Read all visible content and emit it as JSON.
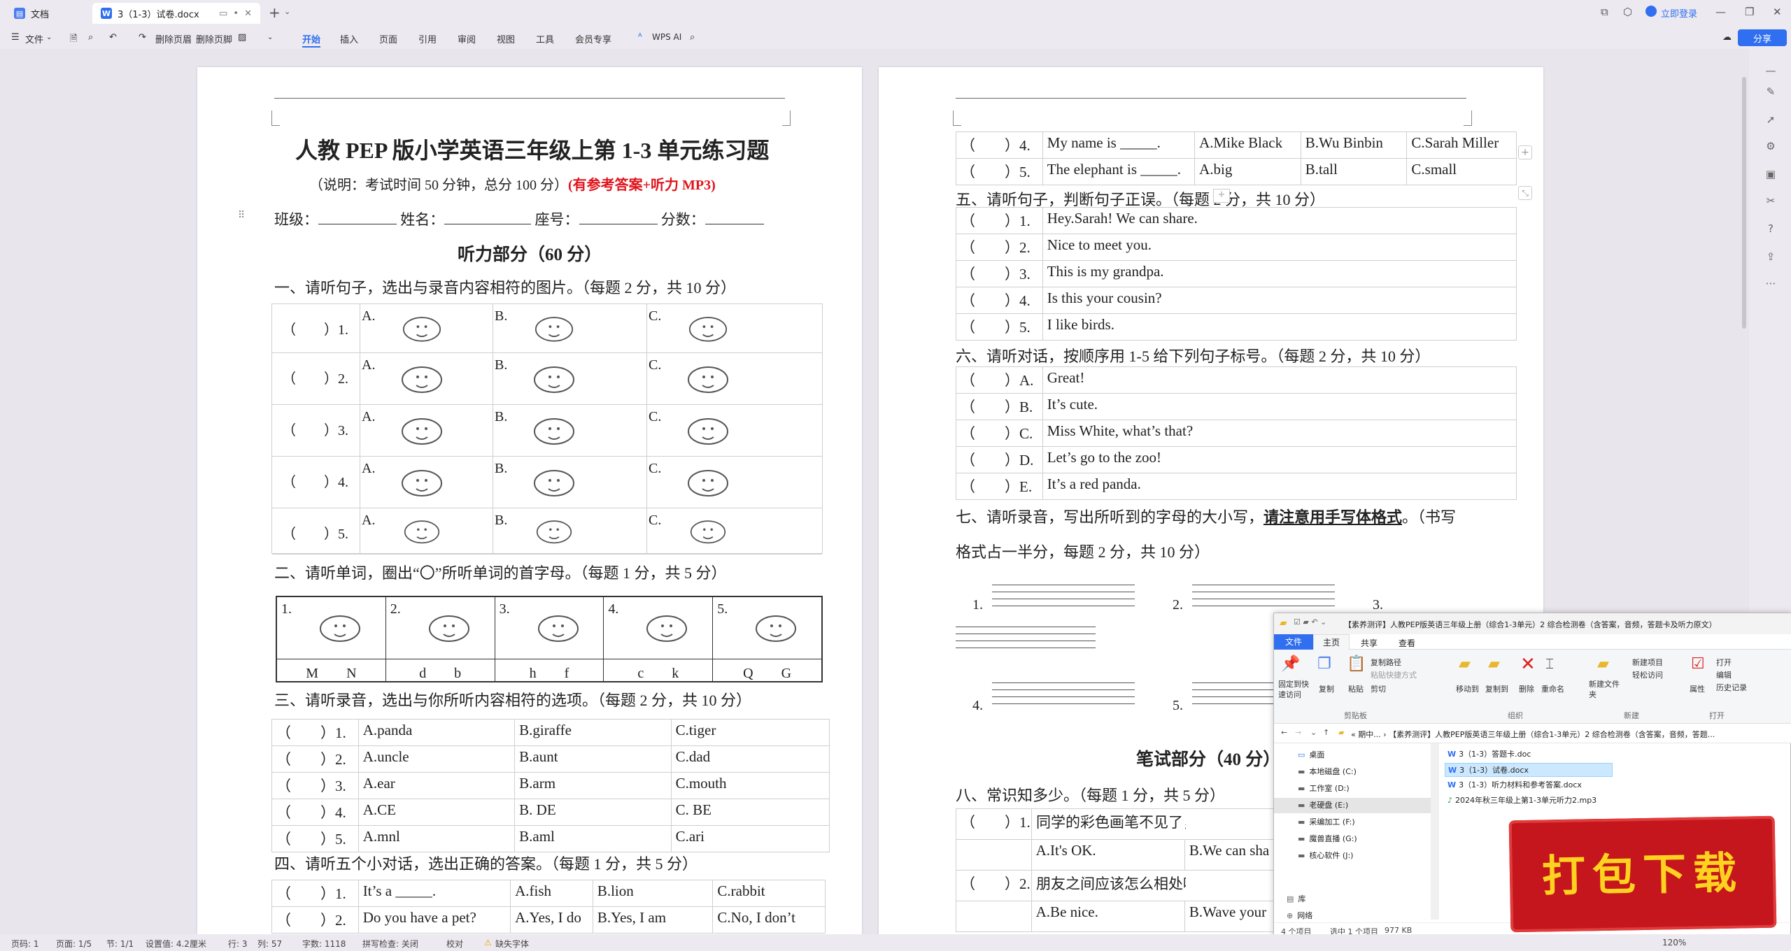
{
  "tabs": {
    "home": "文档",
    "doc": "3（1-3）试卷.docx",
    "login": "立即登录"
  },
  "menu": {
    "file": "文件",
    "delete_header": "删除页眉",
    "delete_footer": "删除页脚",
    "items": [
      "开始",
      "插入",
      "页面",
      "引用",
      "审阅",
      "视图",
      "工具",
      "会员专享"
    ],
    "wps_ai": "WPS AI",
    "share": "分享"
  },
  "page1": {
    "title": "人教 PEP 版小学英语三年级上第 1-3 单元练习题",
    "subtitle": "（说明：考试时间 50 分钟，总分 100 分）",
    "subtitle_red": "(有参考答案+听力 MP3)",
    "info": [
      "班级：",
      "姓名：",
      "座号：",
      "分数："
    ],
    "section_listening": "听力部分（60 分）",
    "q1": "一、请听句子，选出与录音内容相符的图片。（每题 2 分，共 10 分）",
    "q1_rows": [
      "（　　）1.",
      "（　　）2.",
      "（　　）3.",
      "（　　）4.",
      "（　　）5."
    ],
    "q1_opts": [
      "A.",
      "B.",
      "C."
    ],
    "q2": "二、请听单词，圈出“〇”所听单词的首字母。（每题 1 分，共 5 分）",
    "q2_nums": [
      "1.",
      "2.",
      "3.",
      "4.",
      "5."
    ],
    "q2_letters": [
      "M　　N",
      "d　　b",
      "h　　f",
      "c　　k",
      "Q　　G"
    ],
    "q3": "三、请听录音，选出与你所听内容相符的选项。（每题 2 分，共 10 分）",
    "q3_rows": [
      [
        "（　　）1.",
        "A.panda",
        "B.giraffe",
        "C.tiger"
      ],
      [
        "（　　）2.",
        "A.uncle",
        "B.aunt",
        "C.dad"
      ],
      [
        "（　　）3.",
        "A.ear",
        "B.arm",
        "C.mouth"
      ],
      [
        "（　　）4.",
        "A.CE",
        "B. DE",
        "C. BE"
      ],
      [
        "（　　）5.",
        "A.mnl",
        "B.aml",
        "C.ari"
      ]
    ],
    "q4": "四、请听五个小对话，选出正确的答案。（每题 1 分，共 5 分）",
    "q4_rows": [
      [
        "（　　）1.",
        "It’s a _____.",
        "A.fish",
        "B.lion",
        "C.rabbit"
      ],
      [
        "（　　）2.",
        "Do you have a pet?",
        "A.Yes, I do",
        "B.Yes, I am",
        "C.No, I don’t"
      ]
    ]
  },
  "page2": {
    "q4_rows": [
      [
        "（　　）4.",
        "My name is _____.",
        "A.Mike Black",
        "B.Wu Binbin",
        "C.Sarah Miller"
      ],
      [
        "（　　）5.",
        "The elephant is _____.",
        "A.big",
        "B.tall",
        "C.small"
      ]
    ],
    "q5": "五、请听句子，判断句子正误。（每题 2 分，共 10 分）",
    "q5_rows": [
      [
        "（　　）1.",
        "Hey.Sarah! We can share."
      ],
      [
        "（　　）2.",
        "Nice to meet you."
      ],
      [
        "（　　）3.",
        "This is my grandpa."
      ],
      [
        "（　　）4.",
        "Is this your cousin?"
      ],
      [
        "（　　）5.",
        "I like birds."
      ]
    ],
    "q6": "六、请听对话，按顺序用 1-5 给下列句子标号。（每题 2 分，共 10 分）",
    "q6_rows": [
      [
        "（　　）A.",
        "Great!"
      ],
      [
        "（　　）B.",
        "It’s cute."
      ],
      [
        "（　　）C.",
        "Miss White, what’s that?"
      ],
      [
        "（　　）D.",
        "Let’s go to the zoo!"
      ],
      [
        "（　　）E.",
        "It’s a red panda."
      ]
    ],
    "q7_a": "七、请听录音，写出所听到的字母的大小写，",
    "q7_b": "请注意用手写体格式",
    "q7_c": "。（书写",
    "q7_d": "格式占一半分，每题 2 分，共 10 分）",
    "q7_nums": [
      "1.",
      "2.",
      "3.",
      "4.",
      "5."
    ],
    "section_written": "笔试部分（40 分）",
    "q8": "八、常识知多少。（每题 1 分，共 5 分）",
    "q8_rows": [
      [
        "（　　）1.",
        "同学的彩色画笔不见了，你可以怎么"
      ],
      [
        "",
        "A.It's OK.",
        "B.We can sha"
      ],
      [
        "（　　）2.",
        "朋友之间应该怎么相处呢？"
      ],
      [
        "",
        "A.Be nice.",
        "B.Wave your"
      ]
    ]
  },
  "explorer": {
    "title": "【素养测评】人教PEP版英语三年级上册（综合1-3单元）2 综合检测卷（含答案，音频，答题卡及听力原文）",
    "ribbon_tabs": [
      "文件",
      "主页",
      "共享",
      "查看"
    ],
    "ribbon": {
      "pin": "固定到快速访问",
      "copy": "复制",
      "paste": "粘贴",
      "copy_path": "复制路径",
      "paste_shortcut": "粘贴快捷方式",
      "cut": "剪切",
      "clipboard": "剪贴板",
      "move_to": "移动到",
      "copy_to": "复制到",
      "delete": "删除",
      "rename": "重命名",
      "organize": "组织",
      "new_folder": "新建文件夹",
      "new_item": "新建项目",
      "easy_access": "轻松访问",
      "new": "新建",
      "properties": "属性",
      "open": "打开",
      "edit": "编辑",
      "history": "历史记录",
      "open_group": "打开"
    },
    "path": "« 期中... › 【素养测评】人教PEP版英语三年级上册（综合1-3单元）2 综合检测卷（含答案，音频，答题...",
    "nav": [
      "桌面",
      "本地磁盘 (C:)",
      "工作室 (D:)",
      "老硬盘 (E:)",
      "采编加工 (F:)",
      "魔兽直播 (G:)",
      "核心软件 (J:)",
      "库",
      "网络"
    ],
    "files": [
      "3（1-3）答题卡.doc",
      "3（1-3）试卷.docx",
      "3（1-3）听力材料和参考答案.docx",
      "2024年秋三年级上第1-3单元听力2.mp3"
    ],
    "status": [
      "4 个项目",
      "选中 1 个项目",
      "977 KB"
    ]
  },
  "promo": "打包下载",
  "status": {
    "page": "页码: 1",
    "pages": "页面: 1/5",
    "section": "节: 1/1",
    "setting": "设置值: 4.2厘米",
    "row": "行: 3",
    "col": "列: 57",
    "words": "字数: 1118",
    "spell": "拼写检查: 关闭",
    "proof": "校对",
    "missing_font": "缺失字体",
    "zoom": "120%"
  },
  "colors": {
    "accent": "#2f6ff0",
    "red_text": "#e0141c",
    "promo": "#c4161c"
  }
}
